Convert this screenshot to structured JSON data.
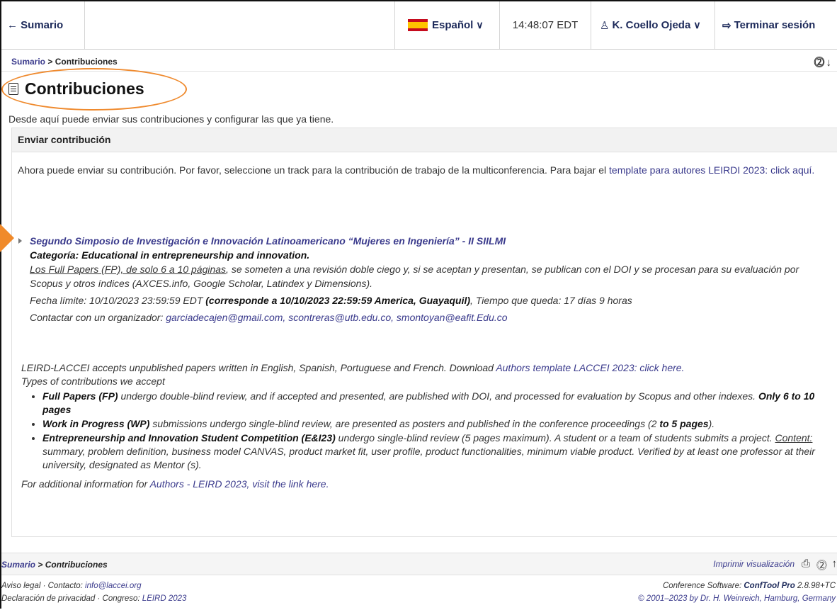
{
  "topbar": {
    "back_label": "← Sumario",
    "language": "Español",
    "time": "14:48:07 EDT",
    "user": "K. Coello Ojeda",
    "logout": "Terminar sesión"
  },
  "breadcrumb": {
    "root": "Sumario",
    "sep": " > ",
    "current": "Contribuciones"
  },
  "page": {
    "title": "Contribuciones",
    "intro": "Desde aquí puede enviar sus contribuciones y configurar las que ya tiene."
  },
  "panel": {
    "title": "Enviar contribución",
    "text_before_link": "Ahora puede enviar su contribución. Por favor, seleccione un track para la contribución de trabajo de la multiconferencia. Para bajar el ",
    "link": "template para autores LEIRDI 2023: click aquí."
  },
  "track": {
    "title": "Segundo Simposio de Investigación e Innovación Latinoamericano “Mujeres en Ingeniería” - II SIILMI",
    "category": "Categoría: Educational in entrepreneurship and innovation.",
    "desc_underlined": "Los Full Papers (FP), de solo 6 a 10 páginas",
    "desc_rest": ", se someten a una revisión doble ciego y, si se aceptan y presentan, se publican con el DOI y se procesan para su evaluación por Scopus y otros índices (AXCES.info, Google Scholar, Latindex y Dimensions).",
    "deadline_prefix": "Fecha límite: 10/10/2023 23:59:59 EDT ",
    "deadline_bold": "(corresponde a 10/10/2023 22:59:59 America, Guayaquil)",
    "deadline_suffix": ", Tiempo que queda: 17 días 9 horas",
    "contact_prefix": "Contactar con un organizador: ",
    "contact_emails": "garciadecajen@gmail.com, scontreras@utb.edu.co, smontoyan@eafit.Edu.co"
  },
  "info": {
    "intro": "LEIRD-LACCEI accepts unpublished papers written in English, Spanish, Portuguese and French. Download ",
    "intro_link": "Authors template LACCEI 2023: click here.",
    "types_label": "Types of contributions we accept",
    "items": [
      {
        "bold": "Full Papers (FP)",
        "text": " undergo double-blind review, and if accepted and presented, are published with DOI, and processed for evaluation by Scopus and other indexes. ",
        "bold2": "Only 6 to 10 pages"
      },
      {
        "bold": "Work in Progress (WP)",
        "text": " submissions undergo single-blind review, are presented as posters and published in the conference proceedings (2 ",
        "bold2": "to 5 pages",
        "tail": ")."
      },
      {
        "bold": "Entrepreneurship and Innovation Student Competition (E&I23)",
        "text": " undergo single-blind review (5 pages maximum). A student or a team of students submits a project. ",
        "u": "Content:",
        "text2": " summary, problem definition, business model CANVAS, product market fit, user profile, product functionalities, minimum viable product. Verified by at least one professor at their university, designated as Mentor (s)."
      }
    ],
    "foot_prefix": "For additional information for ",
    "foot_link": "Authors - LEIRD 2023, visit the link here."
  },
  "footer": {
    "crumb_root": "Sumario",
    "crumb_current": " > Contribuciones",
    "print": "Imprimir visualización",
    "legal_1": "Aviso legal · Contacto: ",
    "legal_email": "info@laccei.org",
    "legal_2": "Declaración de privacidad · Congreso: ",
    "legal_congress": "LEIRD 2023",
    "software_prefix": "Conference Software: ",
    "software_name": "ConfTool Pro",
    "software_version": " 2.8.98+TC",
    "copyright": "© 2001–2023 by Dr. H. Weinreich, Hamburg, Germany"
  },
  "colors": {
    "accent": "#ef8a2e",
    "link": "#3a3a8c"
  }
}
